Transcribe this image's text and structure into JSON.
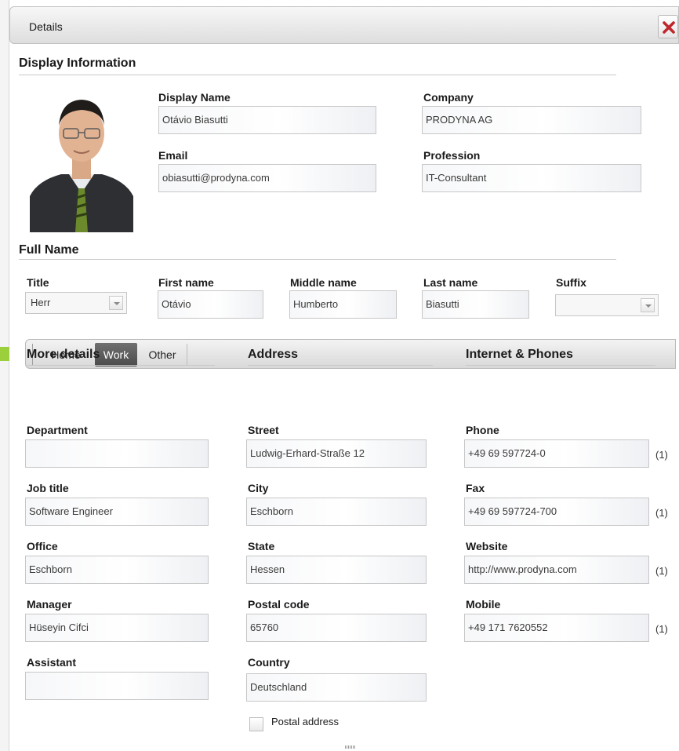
{
  "dialog": {
    "title": "Details"
  },
  "display_info": {
    "heading": "Display Information",
    "display_name": {
      "label": "Display Name",
      "value": "Otávio Biasutti"
    },
    "company": {
      "label": "Company",
      "value": "PRODYNA AG"
    },
    "email": {
      "label": "Email",
      "value": "obiasutti@prodyna.com"
    },
    "profession": {
      "label": "Profession",
      "value": "IT-Consultant"
    }
  },
  "full_name": {
    "heading": "Full Name",
    "title": {
      "label": "Title",
      "value": "Herr"
    },
    "first": {
      "label": "First name",
      "value": "Otávio"
    },
    "middle": {
      "label": "Middle name",
      "value": "Humberto"
    },
    "last": {
      "label": "Last name",
      "value": "Biasutti"
    },
    "suffix": {
      "label": "Suffix",
      "value": ""
    }
  },
  "tabs": [
    "Home",
    "Work",
    "Other"
  ],
  "more_details": {
    "heading": "More details",
    "department": {
      "label": "Department",
      "value": ""
    },
    "job_title": {
      "label": "Job title",
      "value": "Software Engineer"
    },
    "office": {
      "label": "Office",
      "value": "Eschborn"
    },
    "manager": {
      "label": "Manager",
      "value": "Hüseyin Cifci"
    },
    "assistant": {
      "label": "Assistant",
      "value": ""
    }
  },
  "address": {
    "heading": "Address",
    "street": {
      "label": "Street",
      "value": "Ludwig-Erhard-Straße 12"
    },
    "city": {
      "label": "City",
      "value": "Eschborn"
    },
    "state": {
      "label": "State",
      "value": "Hessen"
    },
    "postal_code": {
      "label": "Postal code",
      "value": "65760"
    },
    "country": {
      "label": "Country",
      "value": "Deutschland"
    },
    "postal_address_label": "Postal address"
  },
  "internet": {
    "heading": "Internet & Phones",
    "phone": {
      "label": "Phone",
      "value": "+49 69 597724-0",
      "count": "(1)"
    },
    "fax": {
      "label": "Fax",
      "value": "+49 69 597724-700",
      "count": "(1)"
    },
    "website": {
      "label": "Website",
      "value": "http://www.prodyna.com",
      "count": "(1)"
    },
    "mobile": {
      "label": "Mobile",
      "value": "+49 171 7620552",
      "count": "(1)"
    }
  },
  "icons": {
    "close": "close-icon",
    "dropdown": "chevron-down-icon"
  },
  "colors": {
    "close_x": "#c0272d",
    "active_tab": "#555555",
    "accent_green": "#9bcf3c"
  }
}
